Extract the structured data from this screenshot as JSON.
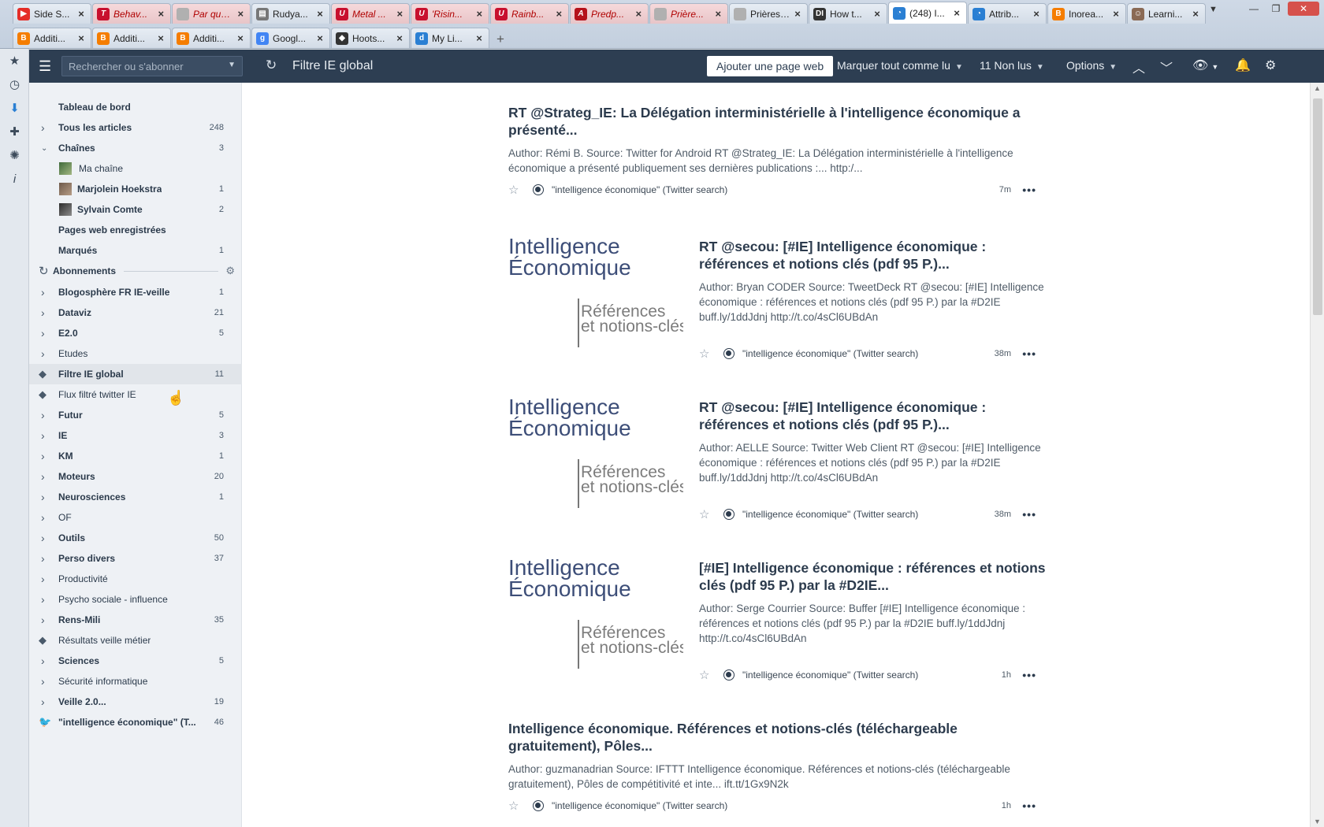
{
  "browser": {
    "tabs_row1": [
      {
        "title": "Side S...",
        "icon": "youtube-icon",
        "color": "#e52d27",
        "highlight": false,
        "active": false
      },
      {
        "title": "Behav...",
        "icon": "t-icon",
        "color": "#c8102e",
        "highlight": true,
        "active": false
      },
      {
        "title": "Par quoi r...",
        "icon": "blank-icon",
        "color": "#b0b0b0",
        "highlight": true,
        "active": false
      },
      {
        "title": "Rudya...",
        "icon": "page-icon",
        "color": "#777777",
        "highlight": false,
        "active": false
      },
      {
        "title": "Metal ...",
        "icon": "u-icon",
        "color": "#c8102e",
        "highlight": true,
        "active": false
      },
      {
        "title": "'Risin...",
        "icon": "u-icon",
        "color": "#c8102e",
        "highlight": true,
        "active": false
      },
      {
        "title": "Rainb...",
        "icon": "u-icon",
        "color": "#c8102e",
        "highlight": true,
        "active": false
      },
      {
        "title": "Predp...",
        "icon": "la-icon",
        "color": "#b5121b",
        "highlight": true,
        "active": false
      },
      {
        "title": "Prière...",
        "icon": "blank-icon",
        "color": "#b0b0b0",
        "highlight": true,
        "active": false
      },
      {
        "title": "Prières à n...",
        "icon": "blank-icon",
        "color": "#b0b0b0",
        "highlight": false,
        "active": false
      },
      {
        "title": "How t...",
        "icon": "di-icon",
        "color": "#333333",
        "highlight": false,
        "active": false
      },
      {
        "title": "(248) I...",
        "icon": "inoreader-icon",
        "color": "#2a7fd3",
        "highlight": false,
        "active": true
      },
      {
        "title": "Attrib...",
        "icon": "inoreader-icon",
        "color": "#2a7fd3",
        "highlight": false,
        "active": false
      },
      {
        "title": "Inorea...",
        "icon": "blogger-icon",
        "color": "#f57d00",
        "highlight": false,
        "active": false
      },
      {
        "title": "Learni...",
        "icon": "avatar-icon",
        "color": "#8a6a55",
        "highlight": false,
        "active": false
      }
    ],
    "tabs_row2": [
      {
        "title": "Additi...",
        "icon": "blogger-icon",
        "color": "#f57d00"
      },
      {
        "title": "Additi...",
        "icon": "blogger-icon",
        "color": "#f57d00"
      },
      {
        "title": "Additi...",
        "icon": "blogger-icon",
        "color": "#f57d00"
      },
      {
        "title": "Googl...",
        "icon": "google-icon",
        "color": "#4285f4"
      },
      {
        "title": "Hoots...",
        "icon": "owl-icon",
        "color": "#333333"
      },
      {
        "title": "My Li...",
        "icon": "d-icon",
        "color": "#2a7fd3"
      }
    ],
    "new_tab": "+"
  },
  "header": {
    "search_placeholder": "Rechercher ou s'abonner",
    "feed_title": "Filtre IE global",
    "add_webpage": "Ajouter une page web",
    "mark_all_read": "Marquer tout comme lu",
    "unread": "11 Non lus",
    "options": "Options"
  },
  "sidebar": {
    "items": [
      {
        "label": "Tableau de bord",
        "count": "",
        "bold": true,
        "type": "plain"
      },
      {
        "label": "Tous les articles",
        "count": "248",
        "bold": true,
        "type": "chev-right"
      },
      {
        "label": "Chaînes",
        "count": "3",
        "bold": true,
        "type": "chev-down"
      },
      {
        "label": "Ma chaîne",
        "count": "",
        "bold": false,
        "type": "avatar-green"
      },
      {
        "label": "Marjolein Hoekstra",
        "count": "1",
        "bold": true,
        "type": "avatar"
      },
      {
        "label": "Sylvain Comte",
        "count": "2",
        "bold": true,
        "type": "avatar-dark"
      },
      {
        "label": "Pages web enregistrées",
        "count": "",
        "bold": true,
        "type": "plain"
      },
      {
        "label": "Marqués",
        "count": "1",
        "bold": true,
        "type": "plain"
      },
      {
        "label": "Abonnements",
        "count": "",
        "bold": true,
        "type": "subs"
      },
      {
        "label": "Blogosphère FR IE-veille",
        "count": "1",
        "bold": true,
        "type": "chev-right"
      },
      {
        "label": "Dataviz",
        "count": "21",
        "bold": true,
        "type": "chev-right"
      },
      {
        "label": "E2.0",
        "count": "5",
        "bold": true,
        "type": "chev-right"
      },
      {
        "label": "Etudes",
        "count": "",
        "bold": false,
        "type": "chev-right"
      },
      {
        "label": "Filtre IE global",
        "count": "11",
        "bold": true,
        "type": "tag",
        "selected": true
      },
      {
        "label": "Flux filtré twitter IE",
        "count": "",
        "bold": false,
        "type": "tag"
      },
      {
        "label": "Futur",
        "count": "5",
        "bold": true,
        "type": "chev-right"
      },
      {
        "label": "IE",
        "count": "3",
        "bold": true,
        "type": "chev-right"
      },
      {
        "label": "KM",
        "count": "1",
        "bold": true,
        "type": "chev-right"
      },
      {
        "label": "Moteurs",
        "count": "20",
        "bold": true,
        "type": "chev-right"
      },
      {
        "label": "Neurosciences",
        "count": "1",
        "bold": true,
        "type": "chev-right"
      },
      {
        "label": "OF",
        "count": "",
        "bold": false,
        "type": "chev-right"
      },
      {
        "label": "Outils",
        "count": "50",
        "bold": true,
        "type": "chev-right"
      },
      {
        "label": "Perso divers",
        "count": "37",
        "bold": true,
        "type": "chev-right"
      },
      {
        "label": "Productivité",
        "count": "",
        "bold": false,
        "type": "chev-right"
      },
      {
        "label": "Psycho sociale - influence",
        "count": "",
        "bold": false,
        "type": "chev-right"
      },
      {
        "label": "Rens-Mili",
        "count": "35",
        "bold": true,
        "type": "chev-right"
      },
      {
        "label": "Résultats veille métier",
        "count": "",
        "bold": false,
        "type": "tag"
      },
      {
        "label": "Sciences",
        "count": "5",
        "bold": true,
        "type": "chev-right"
      },
      {
        "label": "Sécurité informatique",
        "count": "",
        "bold": false,
        "type": "chev-right"
      },
      {
        "label": "Veille 2.0...",
        "count": "19",
        "bold": true,
        "type": "chev-right"
      },
      {
        "label": "\"intelligence économique\" (T...",
        "count": "46",
        "bold": true,
        "type": "twitter"
      }
    ]
  },
  "thumbnail": {
    "line1": "Intelligence",
    "line2": "Économique",
    "line3": "Références",
    "line4": "et notions-clés"
  },
  "articles": [
    {
      "title": "RT @Strateg_IE: La Délégation interministérielle à l'intelligence économique a présenté...",
      "summary": "Author: Rémi B. Source: Twitter for Android RT @Strateg_IE: La Délégation interministérielle à l'intelligence économique a présenté publiquement ses dernières publications :... http:/...",
      "source": "\"intelligence économique\" (Twitter search)",
      "time": "7m",
      "image": false
    },
    {
      "title": "RT @secou: [#IE] Intelligence économique : références et notions clés (pdf 95 P.)...",
      "summary": "Author: Bryan CODER Source: TweetDeck RT @secou: [#IE] Intelligence économique : références et notions clés (pdf 95 P.) par la #D2IE buff.ly/1ddJdnj http://t.co/4sCl6UBdAn",
      "source": "\"intelligence économique\" (Twitter search)",
      "time": "38m",
      "image": true
    },
    {
      "title": "RT @secou: [#IE] Intelligence économique : références et notions clés (pdf 95 P.)...",
      "summary": "Author: AELLE Source: Twitter Web Client RT @secou: [#IE] Intelligence économique : références et notions clés (pdf 95 P.) par la #D2IE buff.ly/1ddJdnj http://t.co/4sCl6UBdAn",
      "source": "\"intelligence économique\" (Twitter search)",
      "time": "38m",
      "image": true
    },
    {
      "title": "[#IE] Intelligence économique : références et notions clés (pdf 95 P.) par la #D2IE...",
      "summary": "Author: Serge Courrier Source: Buffer [#IE] Intelligence économique : références et notions clés (pdf 95 P.) par la #D2IE buff.ly/1ddJdnj http://t.co/4sCl6UBdAn",
      "source": "\"intelligence économique\" (Twitter search)",
      "time": "1h",
      "image": true
    },
    {
      "title": "Intelligence économique. Références et notions-clés (téléchargeable gratuitement), Pôles...",
      "summary": "Author: guzmanadrian Source: IFTTT Intelligence économique. Références et notions-clés (téléchargeable gratuitement), Pôles de compétitivité et inte... ift.tt/1Gx9N2k",
      "source": "\"intelligence économique\" (Twitter search)",
      "time": "1h",
      "image": false
    }
  ]
}
